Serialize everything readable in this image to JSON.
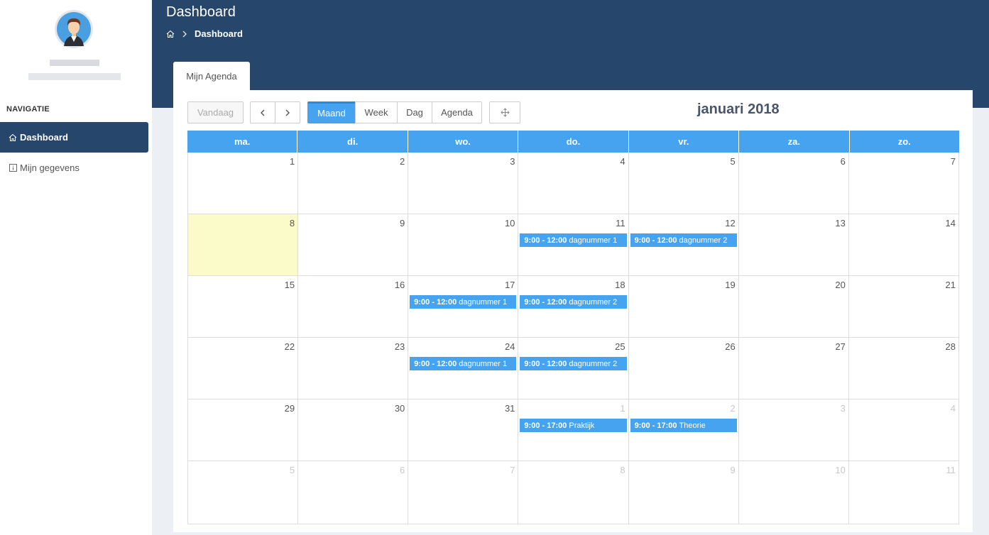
{
  "navigation": {
    "heading": "NAVIGATIE",
    "items": [
      {
        "label": "Dashboard",
        "icon": "home-icon",
        "active": true
      },
      {
        "label": "Mijn gegevens",
        "icon": "info-icon",
        "active": false
      }
    ]
  },
  "header": {
    "title": "Dashboard",
    "breadcrumb_current": "Dashboard"
  },
  "tab": {
    "label": "Mijn Agenda"
  },
  "toolbar": {
    "today": "Vandaag",
    "views": [
      "Maand",
      "Week",
      "Dag",
      "Agenda"
    ],
    "active_view": "Maand",
    "title": "januari 2018"
  },
  "calendar": {
    "weekdays": [
      "ma.",
      "di.",
      "wo.",
      "do.",
      "vr.",
      "za.",
      "zo."
    ],
    "weeks": [
      [
        {
          "d": "1"
        },
        {
          "d": "2"
        },
        {
          "d": "3"
        },
        {
          "d": "4"
        },
        {
          "d": "5"
        },
        {
          "d": "6"
        },
        {
          "d": "7"
        }
      ],
      [
        {
          "d": "8",
          "today": true
        },
        {
          "d": "9"
        },
        {
          "d": "10"
        },
        {
          "d": "11",
          "event": {
            "time": "9:00 - 12:00",
            "title": "dagnummer 1"
          }
        },
        {
          "d": "12",
          "event": {
            "time": "9:00 - 12:00",
            "title": "dagnummer 2"
          }
        },
        {
          "d": "13"
        },
        {
          "d": "14"
        }
      ],
      [
        {
          "d": "15"
        },
        {
          "d": "16"
        },
        {
          "d": "17",
          "event": {
            "time": "9:00 - 12:00",
            "title": "dagnummer 1"
          }
        },
        {
          "d": "18",
          "event": {
            "time": "9:00 - 12:00",
            "title": "dagnummer 2"
          }
        },
        {
          "d": "19"
        },
        {
          "d": "20"
        },
        {
          "d": "21"
        }
      ],
      [
        {
          "d": "22"
        },
        {
          "d": "23"
        },
        {
          "d": "24",
          "event": {
            "time": "9:00 - 12:00",
            "title": "dagnummer 1"
          }
        },
        {
          "d": "25",
          "event": {
            "time": "9:00 - 12:00",
            "title": "dagnummer 2"
          }
        },
        {
          "d": "26"
        },
        {
          "d": "27"
        },
        {
          "d": "28"
        }
      ],
      [
        {
          "d": "29"
        },
        {
          "d": "30"
        },
        {
          "d": "31"
        },
        {
          "d": "1",
          "other": true,
          "event": {
            "time": "9:00 - 17:00",
            "title": "Praktijk"
          }
        },
        {
          "d": "2",
          "other": true,
          "event": {
            "time": "9:00 - 17:00",
            "title": "Theorie"
          }
        },
        {
          "d": "3",
          "other": true
        },
        {
          "d": "4",
          "other": true
        }
      ],
      [
        {
          "d": "5",
          "other": true
        },
        {
          "d": "6",
          "other": true
        },
        {
          "d": "7",
          "other": true
        },
        {
          "d": "8",
          "other": true
        },
        {
          "d": "9",
          "other": true
        },
        {
          "d": "10",
          "other": true
        },
        {
          "d": "11",
          "other": true
        }
      ]
    ]
  },
  "colors": {
    "header": "#26476b",
    "accent": "#45a3f0",
    "today": "#fafbc8"
  }
}
